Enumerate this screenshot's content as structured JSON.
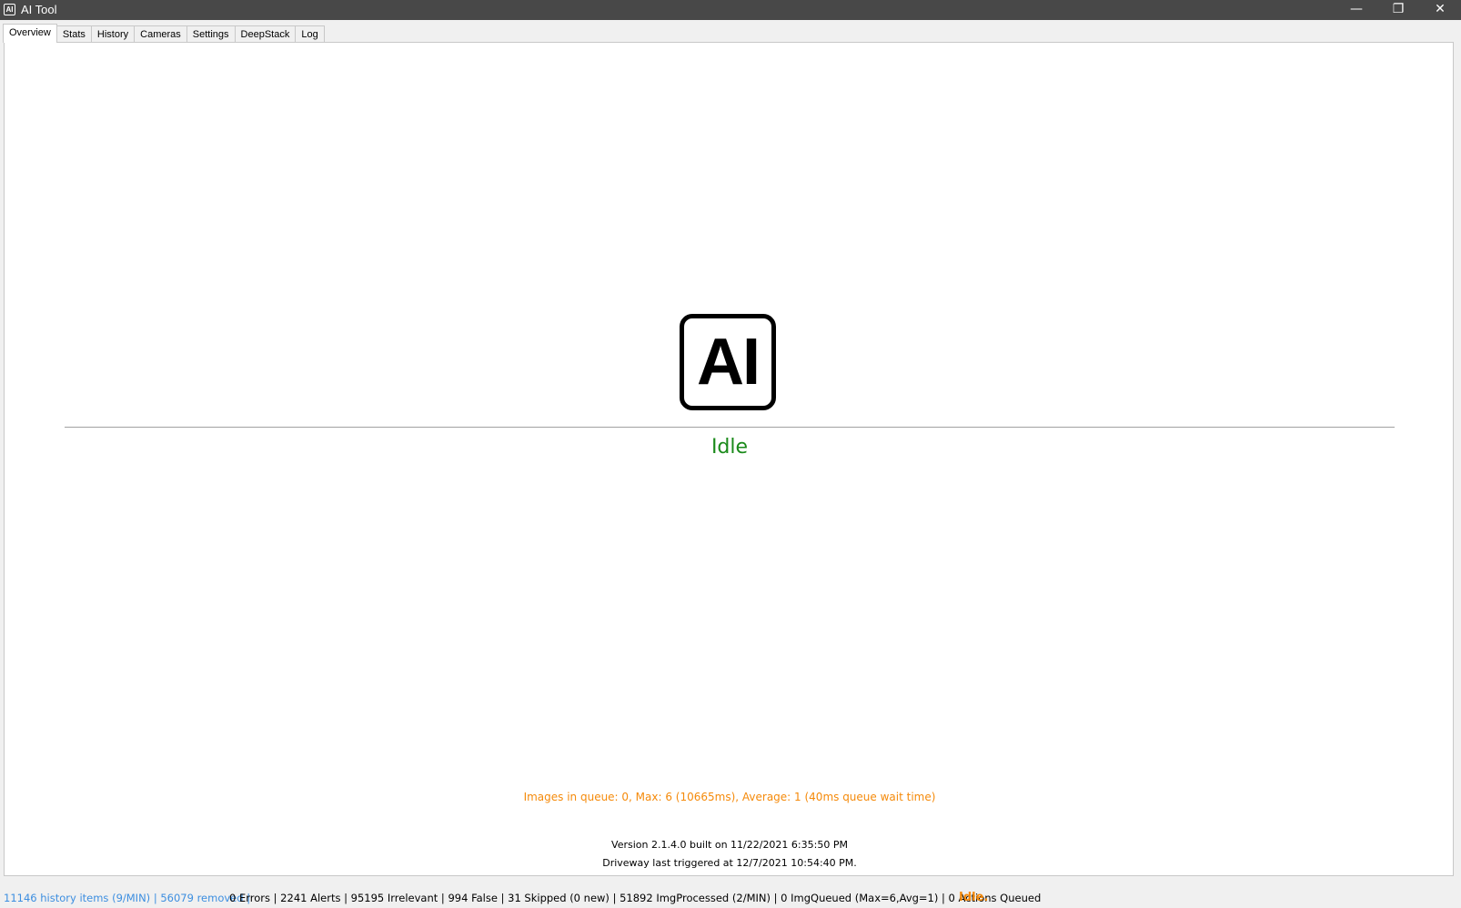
{
  "window": {
    "title": "AI Tool",
    "icon": "ai-logo-icon",
    "minimize_glyph": "—",
    "maximize_glyph": "❐",
    "close_glyph": "✕"
  },
  "tabs": [
    {
      "label": "Overview",
      "active": true
    },
    {
      "label": "Stats"
    },
    {
      "label": "History"
    },
    {
      "label": "Cameras"
    },
    {
      "label": "Settings"
    },
    {
      "label": "DeepStack"
    },
    {
      "label": "Log"
    }
  ],
  "overview": {
    "logo_text": "AI",
    "status": "Idle",
    "queue_info": "Images in queue: 0, Max: 6 (10665ms), Average: 1 (40ms queue wait time)",
    "version_info": "Version 2.1.4.0 built on 11/22/2021 6:35:50 PM",
    "trigger_info": "Driveway last triggered at 12/7/2021 10:54:40 PM."
  },
  "statusbar": {
    "history": "11146 history items (9/MIN) | 56079 removed |",
    "stats": "0 Errors  | 2241 Alerts | 95195 Irrelevant | 994 False | 31 Skipped (0 new) | 51892 ImgProcessed (2/MIN) | 0 ImgQueued (Max=6,Avg=1) | 0 Actions Queued",
    "state": "Idle."
  },
  "colors": {
    "titlebar": "#484848",
    "status_green": "#1a8a1a",
    "queue_orange": "#f58a0a",
    "link_blue": "#3c8ee0"
  }
}
